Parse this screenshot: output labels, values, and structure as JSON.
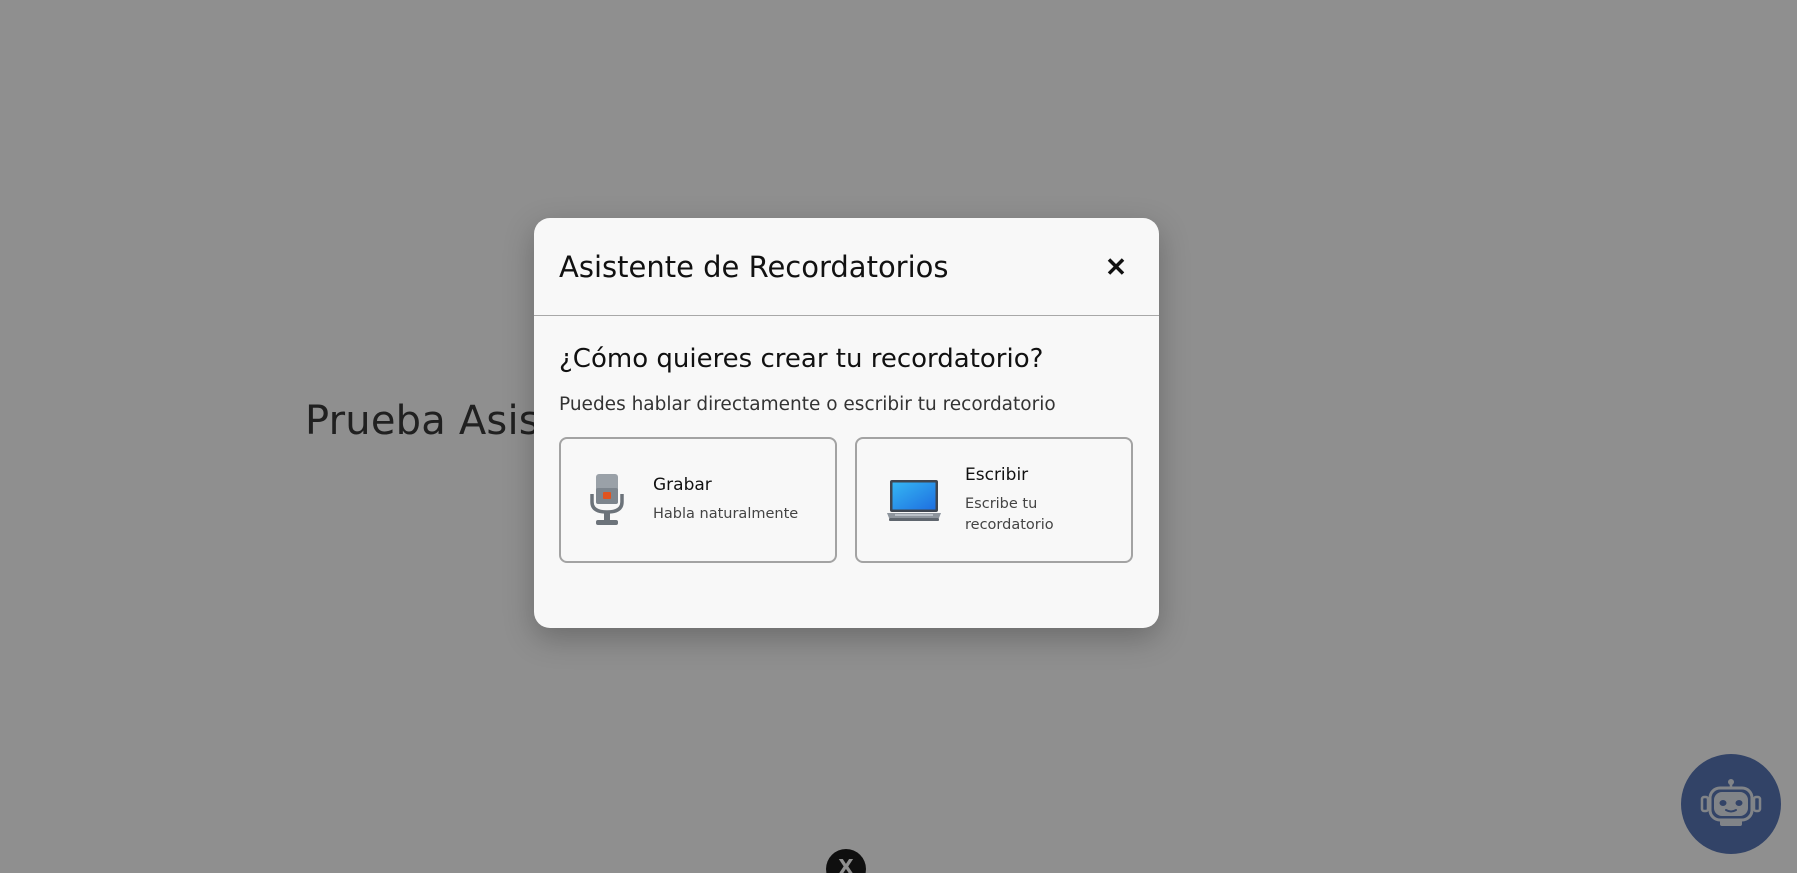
{
  "page": {
    "heading": "Prueba Asist",
    "bottom_badge": "X"
  },
  "modal": {
    "title": "Asistente de Recordatorios",
    "close_symbol": "✕",
    "question": "¿Cómo quieres crear tu recordatorio?",
    "subtitle": "Puedes hablar directamente o escribir tu recordatorio",
    "options": [
      {
        "title": "Grabar",
        "description": "Habla naturalmente",
        "icon": "microphone-icon"
      },
      {
        "title": "Escribir",
        "description": "Escribe tu recordatorio",
        "icon": "laptop-icon"
      }
    ]
  },
  "assistant_fab": {
    "icon": "robot-icon"
  },
  "colors": {
    "overlay": "#8c8c8c",
    "modal_bg": "#f8f8f8",
    "fab": "#3d4f75",
    "card_border": "#a3a3a3"
  }
}
